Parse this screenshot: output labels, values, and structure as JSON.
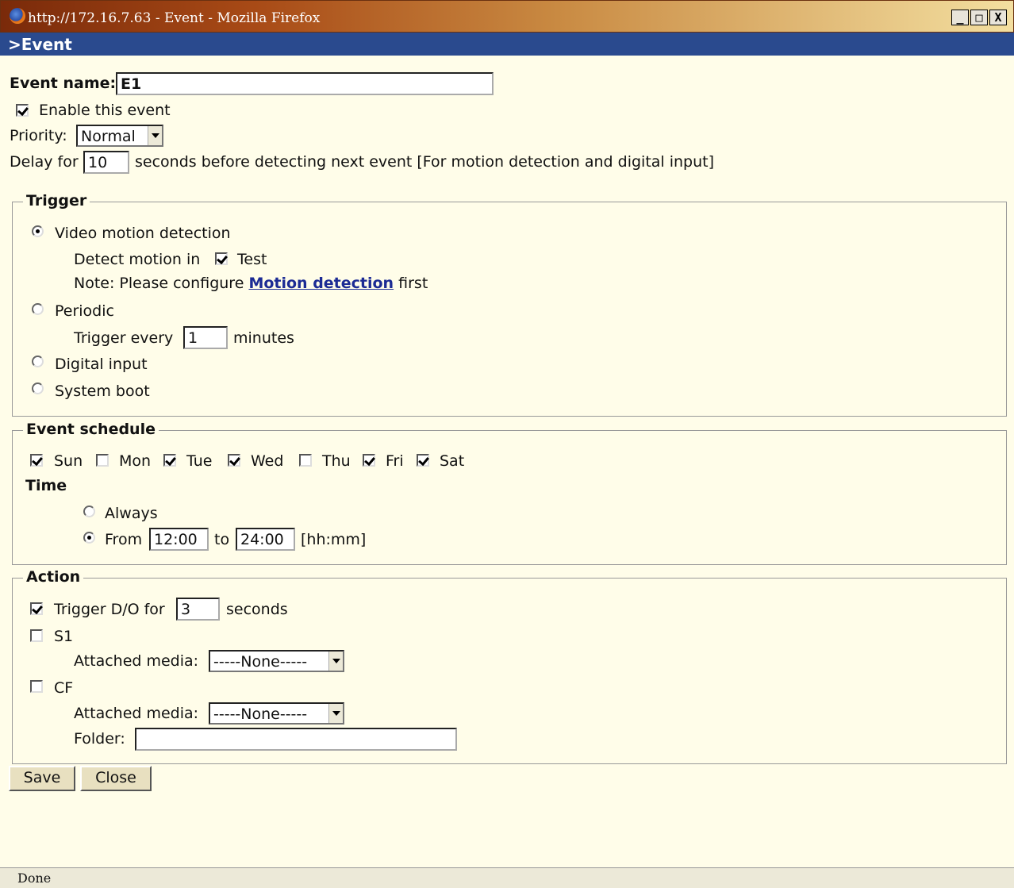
{
  "window": {
    "title": "http://172.16.7.63 - Event - Mozilla Firefox",
    "buttons": {
      "minimize": "_",
      "maximize": "□",
      "close": "X"
    }
  },
  "header": {
    "title": ">Event"
  },
  "general": {
    "event_name_label": "Event name:",
    "event_name_value": "E1",
    "enable_label": "Enable this event",
    "enable_checked": true,
    "priority_label": "Priority:",
    "priority_value": "Normal",
    "delay_prefix": "Delay for",
    "delay_value": "10",
    "delay_suffix": "seconds before detecting next event [For motion detection and digital input]"
  },
  "trigger": {
    "legend": "Trigger",
    "video_motion_label": "Video motion detection",
    "detect_motion_label": "Detect motion in",
    "test_label": "Test",
    "note_prefix": "Note: Please configure",
    "note_link": "Motion detection",
    "note_suffix": "first",
    "periodic_label": "Periodic",
    "trigger_every_label": "Trigger every",
    "trigger_every_value": "1",
    "minutes_label": "minutes",
    "digital_input_label": "Digital input",
    "system_boot_label": "System boot",
    "selected": "video_motion"
  },
  "schedule": {
    "legend": "Event schedule",
    "days": [
      {
        "label": "Sun",
        "checked": true
      },
      {
        "label": "Mon",
        "checked": false
      },
      {
        "label": "Tue",
        "checked": true
      },
      {
        "label": "Wed",
        "checked": true
      },
      {
        "label": "Thu",
        "checked": false
      },
      {
        "label": "Fri",
        "checked": true
      },
      {
        "label": "Sat",
        "checked": true
      }
    ],
    "time_label": "Time",
    "always_label": "Always",
    "from_label": "From",
    "from_value": "12:00",
    "to_label": "to",
    "to_value": "24:00",
    "format_label": "[hh:mm]",
    "selected": "from"
  },
  "action": {
    "legend": "Action",
    "trigger_do_label": "Trigger D/O for",
    "trigger_do_value": "3",
    "seconds_label": "seconds",
    "s1_label": "S1",
    "attached_media_label": "Attached media:",
    "s1_media": "-----None-----",
    "cf_label": "CF",
    "cf_media": "-----None-----",
    "folder_label": "Folder:",
    "folder_value": ""
  },
  "buttons": {
    "save": "Save",
    "close": "Close"
  },
  "status": {
    "text": "Done"
  }
}
